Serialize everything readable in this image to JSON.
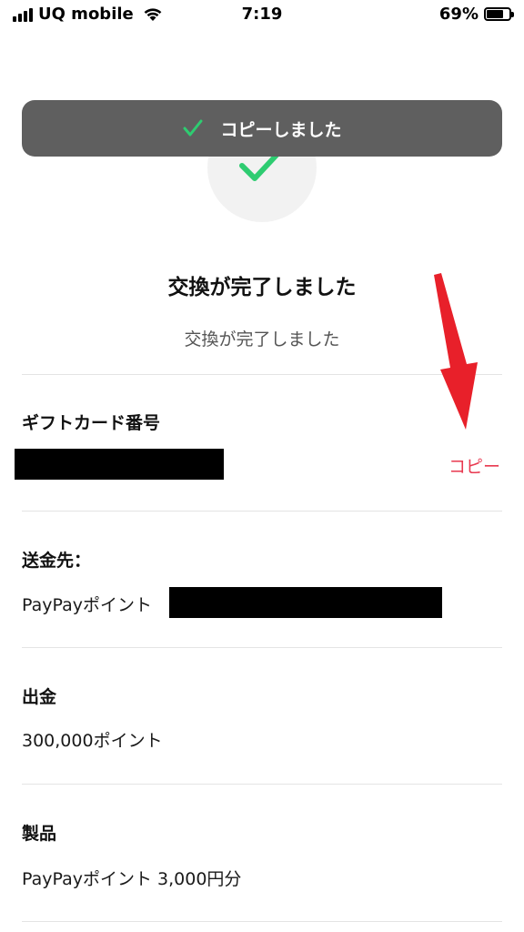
{
  "status_bar": {
    "carrier": "UQ mobile",
    "time": "7:19",
    "battery_percent": "69%"
  },
  "toast": {
    "message": "コピーしました"
  },
  "main": {
    "title": "交換が完了しました",
    "subtitle": "交換が完了しました"
  },
  "gift_card": {
    "label": "ギフトカード番号",
    "copy_label": "コピー"
  },
  "recipient": {
    "label": "送金先：",
    "value": "PayPayポイント"
  },
  "withdrawal": {
    "label": "出金",
    "value": "300,000ポイント"
  },
  "product": {
    "label": "製品",
    "value": "PayPayポイント 3,000円分"
  },
  "colors": {
    "accent_copy": "#e8384f",
    "check_green": "#2ecc71",
    "toast_bg": "#5f5f5f",
    "annotation_arrow": "#e8202a"
  }
}
